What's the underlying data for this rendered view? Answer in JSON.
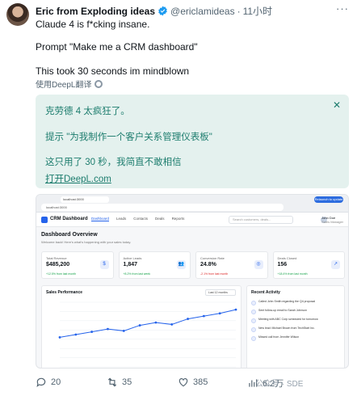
{
  "tweet": {
    "display_name": "Eric from Exploding ideas",
    "handle": "@ericlamideas",
    "separator": "·",
    "time": "11小时",
    "more": "···",
    "line1": "Claude 4 is f*cking insane.",
    "line2": "Prompt \"Make me a CRM dashboard\"",
    "line3": "This took 30 seconds im mindblown",
    "translate_label": "使用DeepL翻译",
    "colors": {
      "text": "#0f1419",
      "muted": "#536471",
      "verified": "#1d9bf0",
      "translation_bg": "#e4f1ee",
      "translation_text": "#1d7d6e"
    }
  },
  "translation": {
    "line1": "克劳德 4 太疯狂了。",
    "line2": "提示 \"为我制作一个客户关系管理仪表板\"",
    "line3": "这只用了 30 秒，我简直不敢相信",
    "link": "打开DeepL.com",
    "close": "✕"
  },
  "screenshot": {
    "browser_tab": "localhost:3000",
    "url": "localhost:3000",
    "browser_pill": "Relaunch to update",
    "app_title": "CRM Dashboard",
    "nav": [
      "Dashboard",
      "Leads",
      "Contacts",
      "Deals",
      "Reports"
    ],
    "search_placeholder": "Search customers, deals...",
    "user_name": "John Doe",
    "user_role": "Sales Manager",
    "overview_title": "Dashboard Overview",
    "welcome": "Welcome back! Here's what's happening with your sales today.",
    "cards": [
      {
        "title": "Total Revenue",
        "value": "$485,200",
        "change": "+12.5% from last month",
        "icon": "$",
        "icon_color": "#2563eb",
        "icon_bg": "#e8eefc",
        "change_color": "#16a34a"
      },
      {
        "title": "Active Leads",
        "value": "1,847",
        "change": "+8.2% from last week",
        "icon": "👥",
        "icon_color": "#2563eb",
        "icon_bg": "#e8eefc",
        "change_color": "#16a34a"
      },
      {
        "title": "Conversion Rate",
        "value": "24.8%",
        "change": "-2.1% from last month",
        "icon": "◎",
        "icon_color": "#2563eb",
        "icon_bg": "#e8eefc",
        "change_color": "#dc2626"
      },
      {
        "title": "Deals Closed",
        "value": "156",
        "change": "+18.4% from last month",
        "icon": "↗",
        "icon_color": "#2563eb",
        "icon_bg": "#e8eefc",
        "change_color": "#16a34a"
      }
    ],
    "perf_title": "Sales Performance",
    "perf_select": "Last 12 months",
    "activity_title": "Recent Activity",
    "activity": [
      {
        "text": "Called John Smith regarding the Q4 proposal",
        "time": ""
      },
      {
        "text": "Sent follow-up email to Sarah Johnson",
        "time": ""
      },
      {
        "text": "Meeting with ABC Corp scheduled for tomorrow",
        "time": ""
      },
      {
        "text": "New lead: Michael Brown from TechStart Inc.",
        "time": ""
      },
      {
        "text": "Missed call from Jennifer Wilson",
        "time": ""
      }
    ]
  },
  "chart_data": {
    "type": "line",
    "title": "Sales Performance",
    "xlabel": "",
    "ylabel": "",
    "x": [
      1,
      2,
      3,
      4,
      5,
      6,
      7,
      8,
      9,
      10,
      11,
      12
    ],
    "series": [
      {
        "name": "",
        "values": [
          32,
          35,
          38,
          41,
          39,
          45,
          48,
          46,
          52,
          55,
          58,
          62
        ]
      }
    ],
    "ylim": [
      0,
      70
    ],
    "grid": true,
    "color": "#2563eb"
  },
  "actions": {
    "replies": "20",
    "retweets": "35",
    "likes": "385",
    "views": "6.2万"
  },
  "watermark": "公众号 · SDE"
}
